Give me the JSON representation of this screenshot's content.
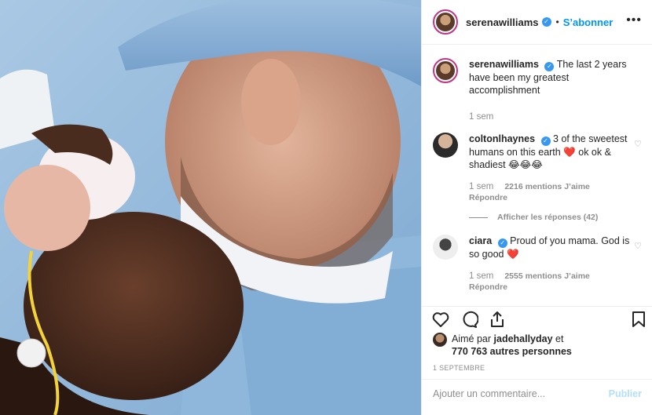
{
  "header": {
    "username": "serenawilliams",
    "verified_mark": "✓",
    "dot": "•",
    "follow_label": "S’abonner",
    "more_label": "•••"
  },
  "caption": {
    "username": "serenawilliams",
    "text": "The last 2 years have been my greatest accomplishment",
    "time": "1 sem"
  },
  "comments": [
    {
      "username": "coltonlhaynes",
      "text": "3 of the sweetest humans on this earth ❤️ ok ok & shadiest 😂😂😂",
      "time": "1 sem",
      "likes": "2216 mentions J’aime",
      "reply": "Répondre",
      "view_replies": "Afficher les réponses (42)"
    },
    {
      "username": "ciara",
      "text": "Proud of you mama. God is so good ❤️",
      "time": "1 sem",
      "likes": "2555 mentions J’aime",
      "reply": "Répondre"
    }
  ],
  "actions": {
    "liked_prefix": "Aimé par",
    "liked_user": "jadehallyday",
    "liked_and": "et",
    "liked_others": "770 763 autres personnes",
    "date": "1 SEPTEMBRE"
  },
  "add_comment": {
    "placeholder": "Ajouter un commentaire...",
    "publish_label": "Publier"
  },
  "icons": [
    "heart-icon",
    "comment-icon",
    "share-icon",
    "bookmark-icon",
    "more-icon",
    "verified-icon"
  ],
  "colors": {
    "accent": "#0095f6",
    "publish_disabled": "#b2dffc",
    "muted": "#8e8e8e",
    "verified": "#3897f0"
  }
}
